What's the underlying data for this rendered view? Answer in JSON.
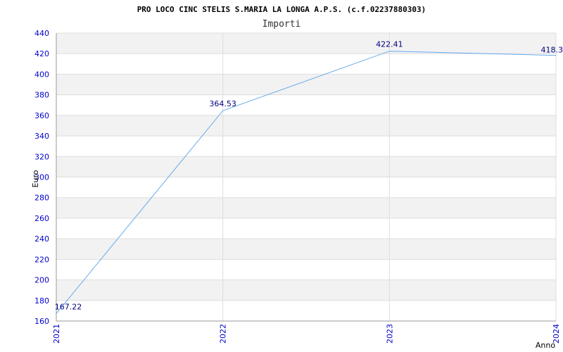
{
  "chart_data": {
    "type": "line",
    "title": "PRO LOCO CINC STELIS S.MARIA LA LONGA A.P.S. (c.f.02237880303)",
    "subtitle": "Importi",
    "xlabel": "Anno",
    "ylabel": "Euro",
    "categories": [
      "2021",
      "2022",
      "2023",
      "2024"
    ],
    "values": [
      167.22,
      364.53,
      422.41,
      418.3
    ],
    "value_labels": [
      "167.22",
      "364.53",
      "422.41",
      "418.3"
    ],
    "ylim": [
      160,
      440
    ],
    "yticks": [
      "160",
      "180",
      "200",
      "220",
      "240",
      "260",
      "280",
      "300",
      "320",
      "340",
      "360",
      "380",
      "400",
      "420",
      "440"
    ],
    "grid": true,
    "line_color": "#66aaee",
    "band_color": "#f2f2f2",
    "tick_color": "#0000cc"
  }
}
